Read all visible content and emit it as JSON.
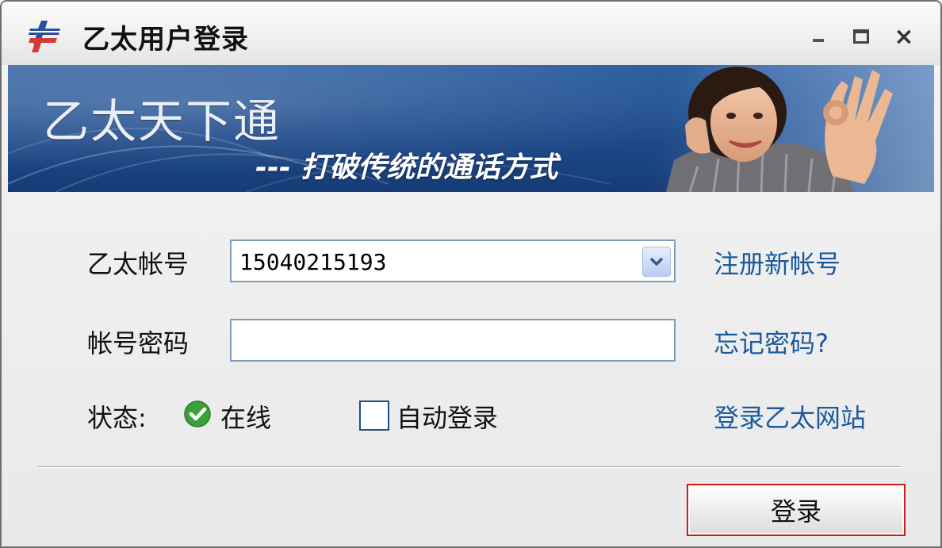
{
  "window": {
    "title": "乙太用户登录",
    "min_label": "",
    "close_label": "×"
  },
  "banner": {
    "title": "乙太天下通",
    "slogan": "--- 打破传统的通话方式"
  },
  "form": {
    "account_label": "乙太帐号",
    "account_value": "15040215193",
    "password_label": "帐号密码",
    "password_value": "",
    "status_label": "状态:",
    "status_value": "在线",
    "auto_login_label": "自动登录",
    "auto_login_checked": false
  },
  "links": {
    "register": "注册新帐号",
    "forgot_password": "忘记密码?",
    "website": "登录乙太网站"
  },
  "actions": {
    "login_label": "登录"
  },
  "colors": {
    "link": "#1a5a9e",
    "banner": "#1f4c8e",
    "login_focus_border": "#d11a1a",
    "status_online": "#3aa23a"
  },
  "icons": {
    "app": "ethernet-app-icon",
    "dropdown": "chevron-down-icon",
    "status": "online-check-icon"
  }
}
